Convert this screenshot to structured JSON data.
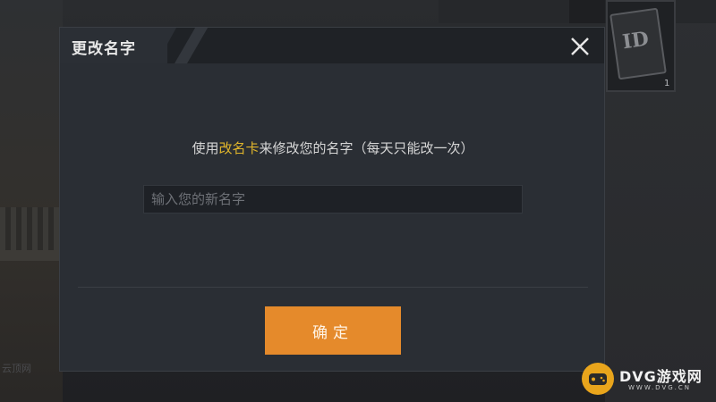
{
  "dialog": {
    "title": "更改名字",
    "message_prefix": "使用",
    "message_highlight": "改名卡",
    "message_suffix": "来修改您的名字（每天只能改一次）",
    "input_placeholder": "输入您的新名字",
    "input_value": "",
    "confirm_label": "确定",
    "close_icon": "close-icon"
  },
  "background": {
    "item_card_label": "ID",
    "item_count": "1",
    "left_watermark": "云顶网"
  },
  "watermark": {
    "brand_name": "DVG游戏网",
    "brand_url": "WWW.DVG.CN"
  },
  "colors": {
    "accent_orange": "#e58a2b",
    "highlight_yellow": "#e0b52b",
    "dialog_bg": "#2a2e34",
    "header_bg": "#1f2226"
  }
}
